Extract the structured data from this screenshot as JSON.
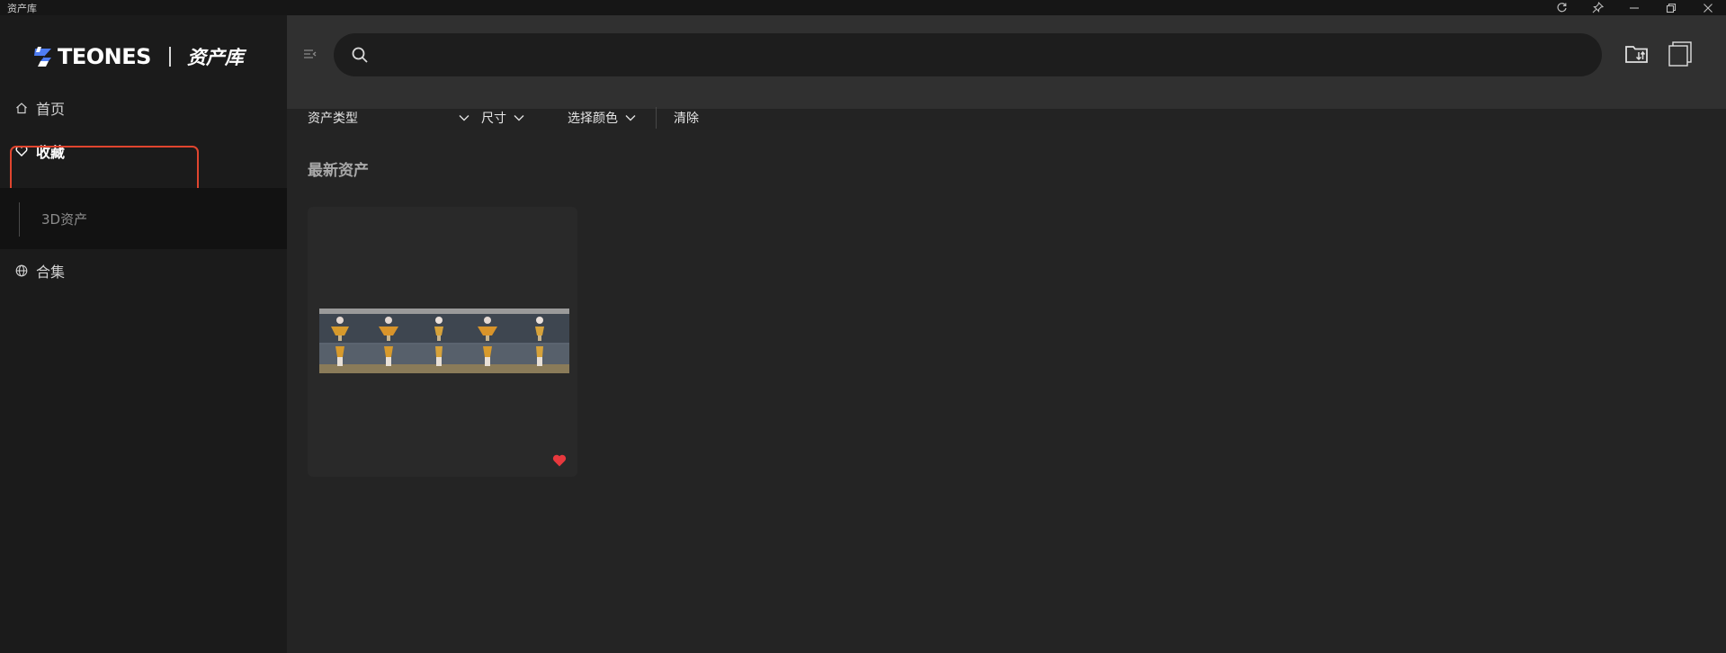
{
  "window": {
    "title": "资产库",
    "controls": [
      "refresh-icon",
      "pin-icon",
      "minimize-icon",
      "restore-icon",
      "close-icon"
    ]
  },
  "sidebar": {
    "brand": "TEONES",
    "app_name": "资产库",
    "items": [
      {
        "label": "首页",
        "icon": "home-icon"
      },
      {
        "label": "收藏",
        "icon": "heart-icon",
        "active": true
      },
      {
        "label": "3D资产",
        "sub": true
      },
      {
        "label": "合集",
        "icon": "globe-icon"
      }
    ]
  },
  "search": {
    "placeholder": "",
    "value": ""
  },
  "filters": {
    "asset_type": "资产类型",
    "size": "尺寸",
    "color": "选择颜色",
    "clear": "清除"
  },
  "main": {
    "section_title": "最新资产",
    "cards": [
      {
        "favorited": true
      }
    ]
  },
  "colors": {
    "accent": "#e0452f",
    "favorite": "#e8383d",
    "sidebar_bg": "#1b1b1b",
    "main_bg": "#242424"
  }
}
